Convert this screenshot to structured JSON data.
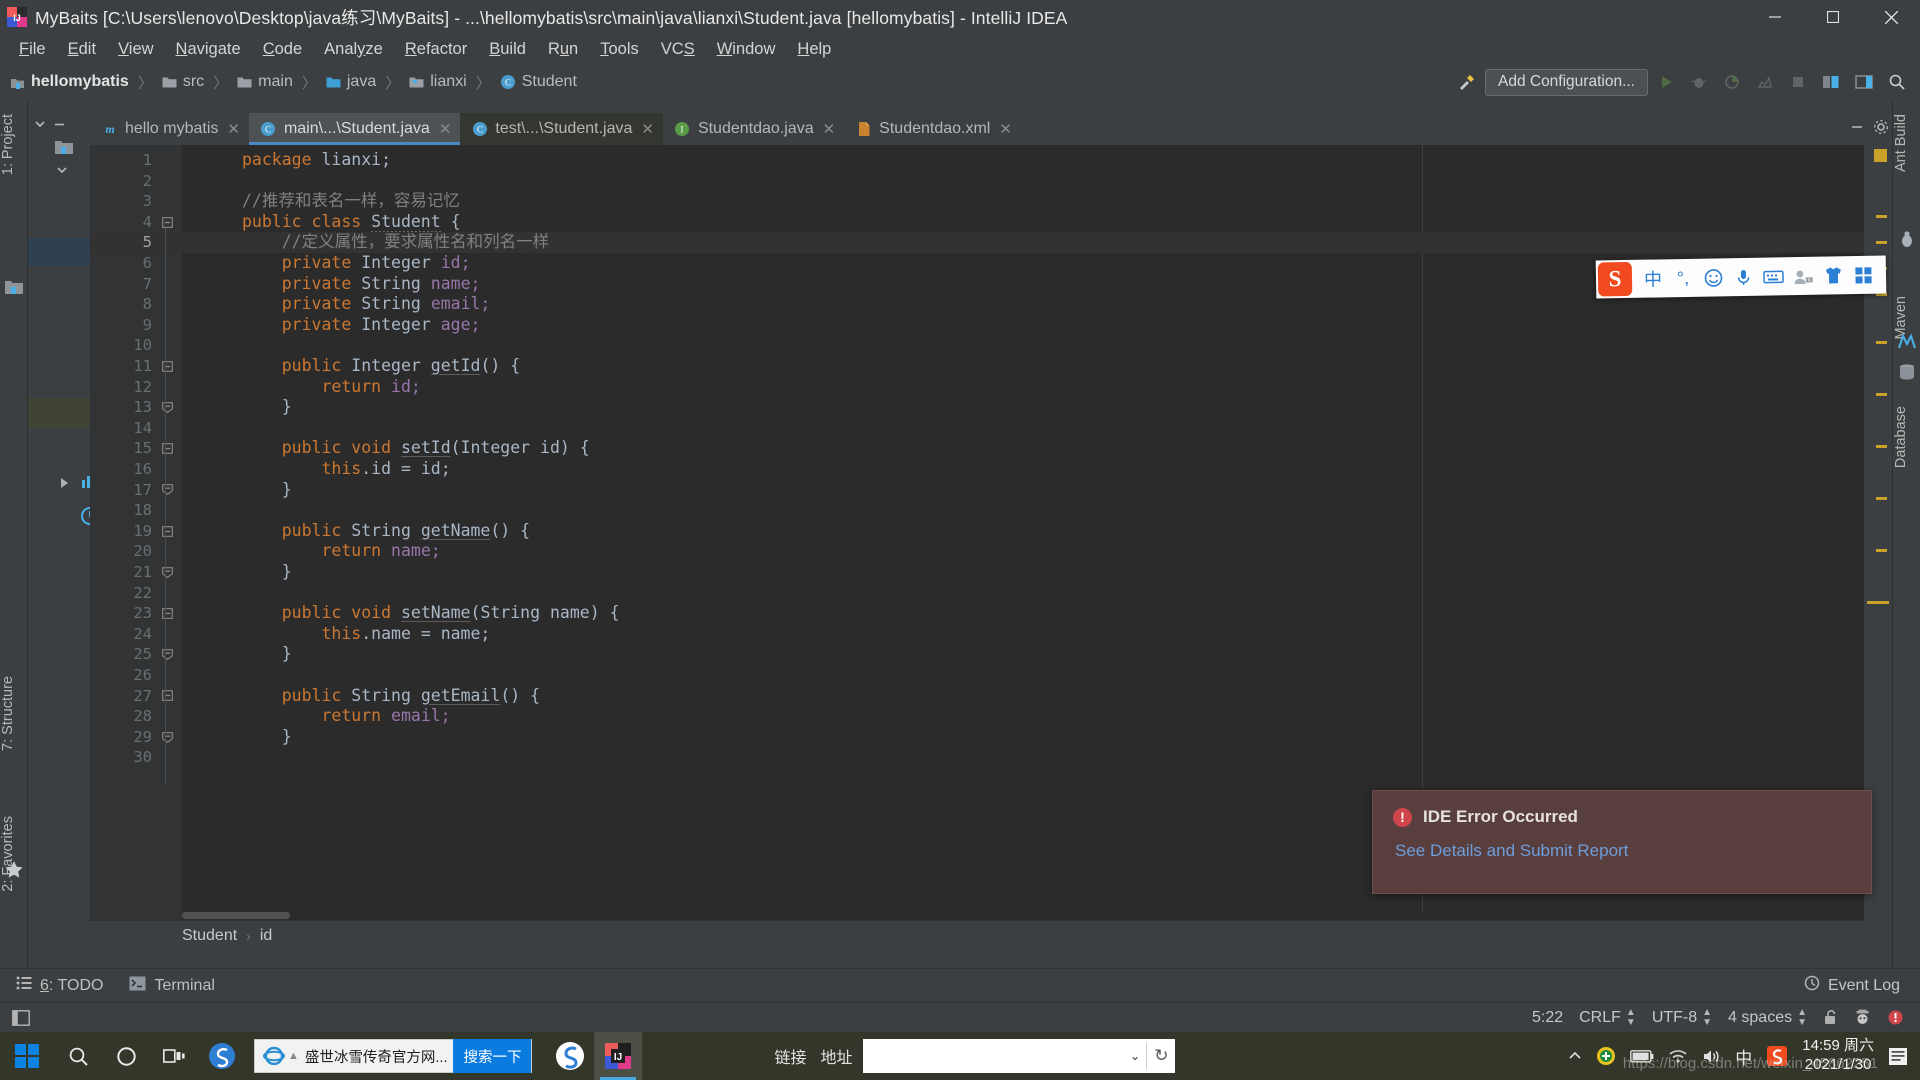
{
  "window": {
    "title": "MyBaits [C:\\Users\\lenovo\\Desktop\\java练习\\MyBaits] - ...\\hellomybatis\\src\\main\\java\\lianxi\\Student.java [hellomybatis] - IntelliJ IDEA",
    "minimize": "—",
    "maximize": "▢",
    "close": "✕"
  },
  "menu": [
    {
      "label": "File",
      "mnemonic": "F"
    },
    {
      "label": "Edit",
      "mnemonic": "E"
    },
    {
      "label": "View",
      "mnemonic": "V"
    },
    {
      "label": "Navigate",
      "mnemonic": "N"
    },
    {
      "label": "Code",
      "mnemonic": "C"
    },
    {
      "label": "Analyze",
      "mnemonic": "y"
    },
    {
      "label": "Refactor",
      "mnemonic": "R"
    },
    {
      "label": "Build",
      "mnemonic": "B"
    },
    {
      "label": "Run",
      "mnemonic": "u"
    },
    {
      "label": "Tools",
      "mnemonic": "T"
    },
    {
      "label": "VCS",
      "mnemonic": "S"
    },
    {
      "label": "Window",
      "mnemonic": "W"
    },
    {
      "label": "Help",
      "mnemonic": "H"
    }
  ],
  "breadcrumb": [
    {
      "label": "hellomybatis",
      "icon": "module-icon"
    },
    {
      "label": "src",
      "icon": "folder-icon"
    },
    {
      "label": "main",
      "icon": "folder-icon"
    },
    {
      "label": "java",
      "icon": "source-folder-icon"
    },
    {
      "label": "lianxi",
      "icon": "package-icon"
    },
    {
      "label": "Student",
      "icon": "class-icon"
    }
  ],
  "toolbar": {
    "add_configuration": "Add Configuration...",
    "hammer_icon": "build-icon",
    "run_icon": "run-icon",
    "debug_icon": "debug-icon",
    "coverage_icon": "coverage-icon",
    "profile_icon": "profile-icon",
    "stop_icon": "stop-icon",
    "search_icon": "search-icon"
  },
  "tabs": [
    {
      "label": "hello mybatis",
      "icon": "maven-icon",
      "state": "inactive",
      "closable": true
    },
    {
      "label": "main\\...\\Student.java",
      "icon": "class-icon",
      "state": "active",
      "closable": true
    },
    {
      "label": "test\\...\\Student.java",
      "icon": "class-icon",
      "state": "green",
      "closable": true
    },
    {
      "label": "Studentdao.java",
      "icon": "interface-icon",
      "state": "inactive",
      "closable": true
    },
    {
      "label": "Studentdao.xml",
      "icon": "xml-icon",
      "state": "inactive",
      "closable": true
    }
  ],
  "left_tool_strip": [
    {
      "label": "1: Project"
    },
    {
      "label": "7: Structure"
    },
    {
      "label": "2: Favorites"
    }
  ],
  "right_tool_strip": [
    {
      "label": "Ant Build"
    },
    {
      "label": "Maven"
    },
    {
      "label": "Database"
    }
  ],
  "editor": {
    "current_line": 5,
    "lines": [
      {
        "n": 1,
        "tokens": [
          {
            "t": "package ",
            "c": "kw"
          },
          {
            "t": "lianxi;",
            "c": "typ"
          }
        ]
      },
      {
        "n": 2,
        "tokens": []
      },
      {
        "n": 3,
        "tokens": [
          {
            "t": "//推荐和表名一样，容易记忆",
            "c": "cmt"
          }
        ]
      },
      {
        "n": 4,
        "tokens": [
          {
            "t": "public class ",
            "c": "kw"
          },
          {
            "t": "Student",
            "c": "cls-err"
          },
          {
            "t": " {",
            "c": "typ"
          }
        ],
        "fold": "open"
      },
      {
        "n": 5,
        "tokens": [
          {
            "t": "    //定义属性，要求属性名和列名一样",
            "c": "cmt"
          }
        ]
      },
      {
        "n": 6,
        "tokens": [
          {
            "t": "    private ",
            "c": "kw"
          },
          {
            "t": "Integer ",
            "c": "typ"
          },
          {
            "t": "id;",
            "c": "fld"
          }
        ]
      },
      {
        "n": 7,
        "tokens": [
          {
            "t": "    private ",
            "c": "kw"
          },
          {
            "t": "String ",
            "c": "typ"
          },
          {
            "t": "name;",
            "c": "fld"
          }
        ]
      },
      {
        "n": 8,
        "tokens": [
          {
            "t": "    private ",
            "c": "kw"
          },
          {
            "t": "String ",
            "c": "typ"
          },
          {
            "t": "email;",
            "c": "fld"
          }
        ]
      },
      {
        "n": 9,
        "tokens": [
          {
            "t": "    private ",
            "c": "kw"
          },
          {
            "t": "Integer ",
            "c": "typ"
          },
          {
            "t": "age;",
            "c": "fld"
          }
        ]
      },
      {
        "n": 10,
        "tokens": []
      },
      {
        "n": 11,
        "tokens": [
          {
            "t": "    public ",
            "c": "kw"
          },
          {
            "t": "Integer ",
            "c": "typ"
          },
          {
            "t": "getId",
            "c": "mth"
          },
          {
            "t": "() {",
            "c": "typ"
          }
        ],
        "fold": "open"
      },
      {
        "n": 12,
        "tokens": [
          {
            "t": "        return ",
            "c": "kw"
          },
          {
            "t": "id;",
            "c": "fld"
          }
        ]
      },
      {
        "n": 13,
        "tokens": [
          {
            "t": "    }",
            "c": "typ"
          }
        ],
        "fold": "close"
      },
      {
        "n": 14,
        "tokens": []
      },
      {
        "n": 15,
        "tokens": [
          {
            "t": "    public void ",
            "c": "kw"
          },
          {
            "t": "setId",
            "c": "mth"
          },
          {
            "t": "(",
            "c": "typ"
          },
          {
            "t": "Integer ",
            "c": "typ"
          },
          {
            "t": "id) {",
            "c": "typ"
          }
        ],
        "fold": "open"
      },
      {
        "n": 16,
        "tokens": [
          {
            "t": "        this",
            "c": "kw"
          },
          {
            "t": ".id = id;",
            "c": "typ"
          }
        ]
      },
      {
        "n": 17,
        "tokens": [
          {
            "t": "    }",
            "c": "typ"
          }
        ],
        "fold": "close"
      },
      {
        "n": 18,
        "tokens": []
      },
      {
        "n": 19,
        "tokens": [
          {
            "t": "    public ",
            "c": "kw"
          },
          {
            "t": "String ",
            "c": "typ"
          },
          {
            "t": "getName",
            "c": "mth"
          },
          {
            "t": "() {",
            "c": "typ"
          }
        ],
        "fold": "open"
      },
      {
        "n": 20,
        "tokens": [
          {
            "t": "        return ",
            "c": "kw"
          },
          {
            "t": "name;",
            "c": "fld"
          }
        ]
      },
      {
        "n": 21,
        "tokens": [
          {
            "t": "    }",
            "c": "typ"
          }
        ],
        "fold": "close"
      },
      {
        "n": 22,
        "tokens": []
      },
      {
        "n": 23,
        "tokens": [
          {
            "t": "    public void ",
            "c": "kw"
          },
          {
            "t": "setName",
            "c": "mth"
          },
          {
            "t": "(",
            "c": "typ"
          },
          {
            "t": "String ",
            "c": "typ"
          },
          {
            "t": "name) {",
            "c": "typ"
          }
        ],
        "fold": "open"
      },
      {
        "n": 24,
        "tokens": [
          {
            "t": "        this",
            "c": "kw"
          },
          {
            "t": ".name = name;",
            "c": "typ"
          }
        ]
      },
      {
        "n": 25,
        "tokens": [
          {
            "t": "    }",
            "c": "typ"
          }
        ],
        "fold": "close"
      },
      {
        "n": 26,
        "tokens": []
      },
      {
        "n": 27,
        "tokens": [
          {
            "t": "    public ",
            "c": "kw"
          },
          {
            "t": "String ",
            "c": "typ"
          },
          {
            "t": "getEmail",
            "c": "mth"
          },
          {
            "t": "() {",
            "c": "typ"
          }
        ],
        "fold": "open"
      },
      {
        "n": 28,
        "tokens": [
          {
            "t": "        return ",
            "c": "kw"
          },
          {
            "t": "email;",
            "c": "fld"
          }
        ]
      },
      {
        "n": 29,
        "tokens": [
          {
            "t": "    }",
            "c": "typ"
          }
        ],
        "fold": "close"
      },
      {
        "n": 30,
        "tokens": []
      }
    ]
  },
  "editor_footer": {
    "class": "Student",
    "member": "id",
    "separator": "›"
  },
  "notification": {
    "title": "IDE Error Occurred",
    "link": "See Details and Submit Report",
    "icon": "error-icon",
    "accent": "#d0454c"
  },
  "ime": {
    "logo": "S",
    "items": [
      "中",
      "°,",
      "☺",
      "🎤",
      "⌨",
      "👤",
      "👕",
      "▦"
    ]
  },
  "toolwindows": [
    {
      "label": "6: TODO",
      "mnemonic": "6",
      "icon": "todo-icon"
    },
    {
      "label": "Terminal",
      "icon": "terminal-icon"
    }
  ],
  "statusbar": {
    "event_log": "Event Log",
    "position": "5:22",
    "line_sep": "CRLF",
    "encoding": "UTF-8",
    "indent": "4 spaces",
    "lock_icon": "unlock-icon",
    "inspector_icon": "hector-icon",
    "error_icon": "error-icon"
  },
  "taskbar": {
    "start_icon": "windows-start-icon",
    "search_icon": "search-icon",
    "cortana_icon": "cortana-icon",
    "taskview_icon": "task-view-icon",
    "ie_text": "盛世冰雪传奇官方网...",
    "ie_search_btn": "搜索一下",
    "links_label": "链接",
    "address_label": "地址",
    "address_value": "",
    "time": "14:59 周六",
    "date": "2021/1/30",
    "ime_lang": "中",
    "watermark": "https://blog.csdn.net/weixin_45862251"
  }
}
